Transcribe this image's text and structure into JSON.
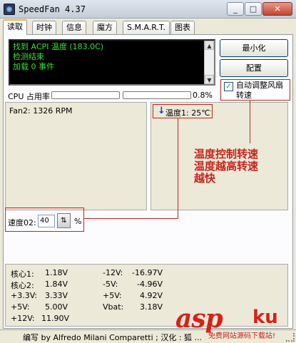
{
  "window": {
    "title": "SpeedFan 4.37",
    "min": "_",
    "max": "□",
    "close": "✕"
  },
  "tabs": [
    "读取",
    "时钟",
    "信息",
    "魔方",
    "S.M.A.R.T.",
    "图表"
  ],
  "log": {
    "lines": [
      "找到 ACPI 温度 (183.0C)",
      "检测结束",
      "加载 0 事件"
    ]
  },
  "buttons": {
    "minimize": "最小化",
    "config": "配置"
  },
  "auto_fan": {
    "label": "自动调整风扇转速",
    "checked": true
  },
  "cpu": {
    "label": "CPU 占用率",
    "usage_percent": "0.8%",
    "bar1_fill": 0.0,
    "bar2_fill": 0.0
  },
  "fan": {
    "reading": "Fan2: 1326 RPM"
  },
  "temperature": {
    "reading": "温度1: 25℃"
  },
  "annotation": {
    "lines": [
      "温度控制转速",
      "温度越高转速",
      "越快"
    ]
  },
  "speed": {
    "label": "速度02:",
    "value": "40",
    "unit": "%"
  },
  "voltages": {
    "left": [
      {
        "label": "核心1:",
        "value": "1.18V"
      },
      {
        "label": "核心2:",
        "value": "1.84V"
      },
      {
        "label": "+3.3V:",
        "value": "3.33V"
      },
      {
        "label": "+5V:",
        "value": "5.00V"
      },
      {
        "label": "+12V:",
        "value": "11.90V"
      }
    ],
    "right": [
      {
        "label": "-12V:",
        "value": "-16.97V"
      },
      {
        "label": "-5V:",
        "value": "-4.96V"
      },
      {
        "label": "+5V:",
        "value": "4.92V"
      },
      {
        "label": "Vbat:",
        "value": "3.18V"
      }
    ]
  },
  "status": {
    "text": "编写 by Alfredo Milani Comparetti ; 汉化 : 狐 ..."
  },
  "watermark": {
    "brand": "asp",
    "brand2": "ku",
    "sub": "免费网站源码下载站!"
  },
  "colors": {
    "accent_red": "#c8231a",
    "log_green": "#36e036",
    "log_bg": "#000000"
  }
}
